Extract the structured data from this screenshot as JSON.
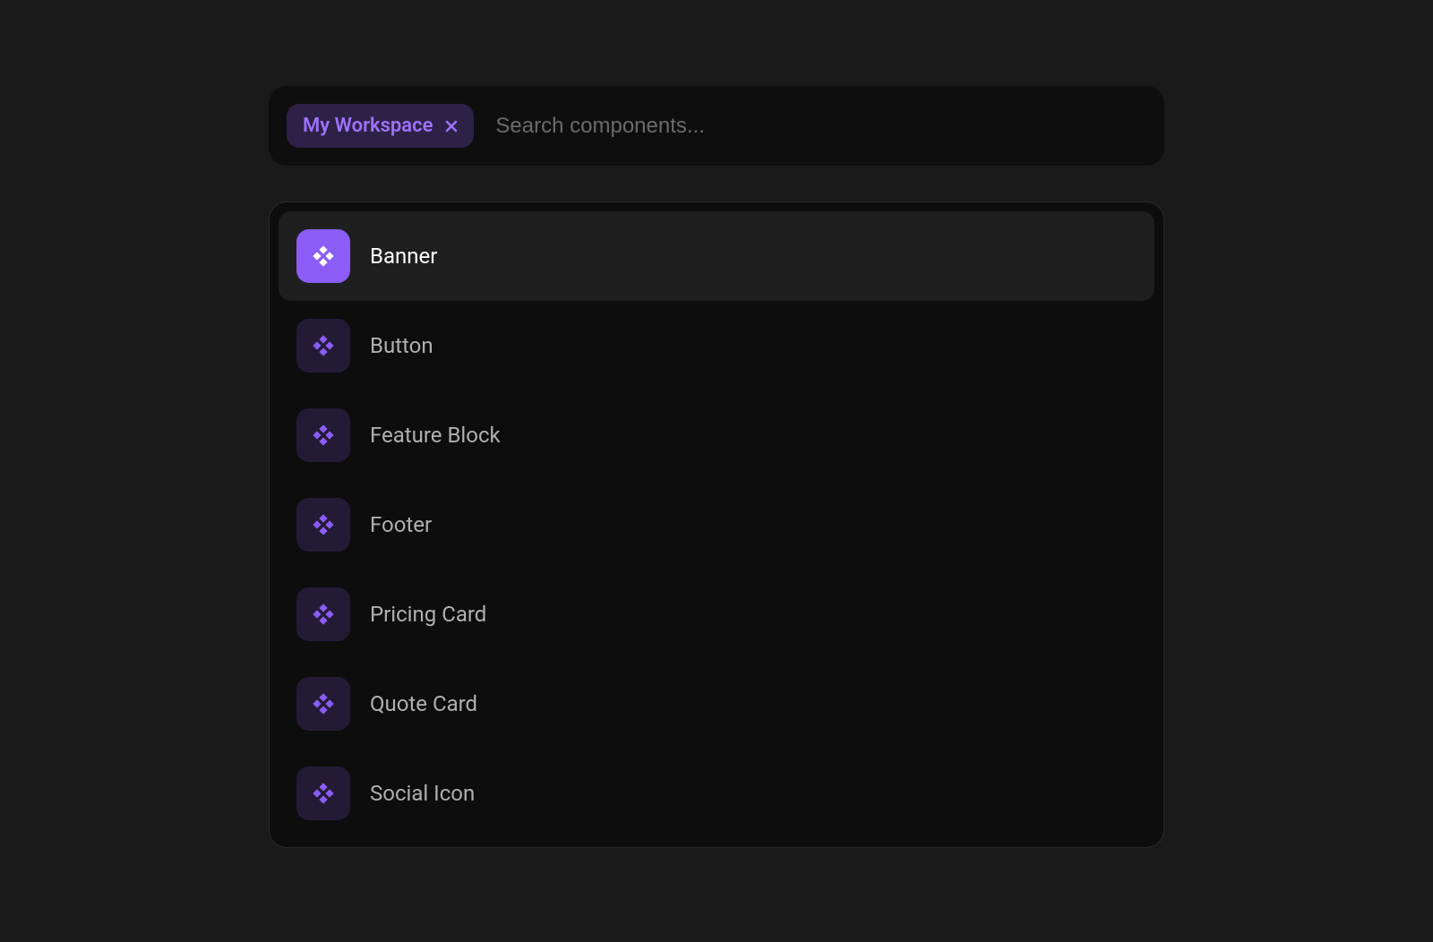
{
  "search": {
    "placeholder": "Search components...",
    "value": ""
  },
  "workspace": {
    "label": "My Workspace"
  },
  "colors": {
    "accent": "#8b5cf6",
    "background": "#1a1a1a",
    "panel": "#0d0d0d"
  },
  "items": [
    {
      "label": "Banner",
      "selected": true
    },
    {
      "label": "Button",
      "selected": false
    },
    {
      "label": "Feature Block",
      "selected": false
    },
    {
      "label": "Footer",
      "selected": false
    },
    {
      "label": "Pricing Card",
      "selected": false
    },
    {
      "label": "Quote Card",
      "selected": false
    },
    {
      "label": "Social Icon",
      "selected": false
    }
  ]
}
